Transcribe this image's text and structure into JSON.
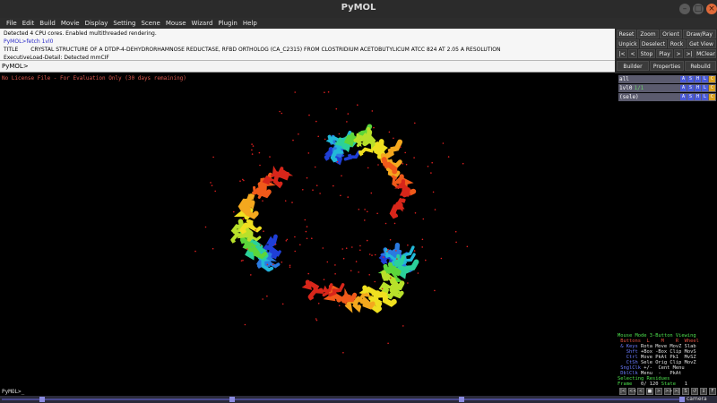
{
  "window": {
    "title": "PyMOL"
  },
  "menu": [
    "File",
    "Edit",
    "Build",
    "Movie",
    "Display",
    "Setting",
    "Scene",
    "Mouse",
    "Wizard",
    "Plugin",
    "Help"
  ],
  "log": {
    "line1": "Detected 4 CPU cores.  Enabled multithreaded rendering.",
    "line2": "PyMOL>fetch 1vl0",
    "line3_key": "TITLE",
    "line3_val": "CRYSTAL STRUCTURE OF A DTDP-4-DEHYDRORHAMNOSE REDUCTASE, RFBD ORTHOLOG (CA_C2315) FROM CLOSTRIDIUM ACETOBUTYLICUM ATCC 824 AT 2.05 A RESOLUTION",
    "line4": " ExecutiveLoad-Detail: Detected mmCIF"
  },
  "command": {
    "prompt": "PyMOL>",
    "value": ""
  },
  "buttons": {
    "row1": [
      "Reset",
      "Zoom",
      "Orient",
      "Draw/Ray"
    ],
    "row2": [
      "Unpick",
      "Deselect",
      "Rock",
      "Get View"
    ],
    "row3": [
      "|<",
      "<",
      "Stop",
      "Play",
      ">",
      ">|",
      "MClear"
    ],
    "row4": [
      "Builder",
      "Properties",
      "Rebuild"
    ]
  },
  "viewer": {
    "license": "No License File - For Evaluation Only (30 days remaining)"
  },
  "objects": [
    {
      "name": "all",
      "state": ""
    },
    {
      "name": "1vl0",
      "state": "1/1"
    },
    {
      "name": "(sele)",
      "state": ""
    }
  ],
  "object_actions": [
    "A",
    "S",
    "H",
    "L",
    "C"
  ],
  "object_action_colors": [
    "#4a5ad8",
    "#4a5ad8",
    "#4a5ad8",
    "#4a5ad8",
    "#d8a020"
  ],
  "mouse": {
    "header1": "Mouse Mode",
    "header2": "3-Button Viewing",
    "buttons_row": " Buttons  L    M    R  Wheel",
    "rows": [
      {
        "k": " & Keys",
        "v": " Rota Move MovZ Slab"
      },
      {
        "k": "   Shft",
        "v": " +Box -Box Clip MovS"
      },
      {
        "k": "   Ctrl",
        "v": " Move PkAt Pk1  MvSZ"
      },
      {
        "k": "   CtSh",
        "v": " Sele Orig Clip MovZ"
      },
      {
        "k": " SnglClk",
        "v": " +/-  Cent Menu"
      },
      {
        "k": " DblClk",
        "v": " Menu  -   PkAt"
      }
    ],
    "selecting": "Selecting Residues",
    "frame_label": "Frame",
    "frame_value": "0/ 120",
    "state_label": "State",
    "state_value": "1"
  },
  "playback": [
    "|<",
    "<<",
    "<",
    "■",
    ">",
    ">>",
    ">|",
    "S",
    "↺",
    "↕",
    "F"
  ],
  "bottom": {
    "prompt": "PyMOL>_"
  },
  "movie": {
    "label": "camera"
  }
}
